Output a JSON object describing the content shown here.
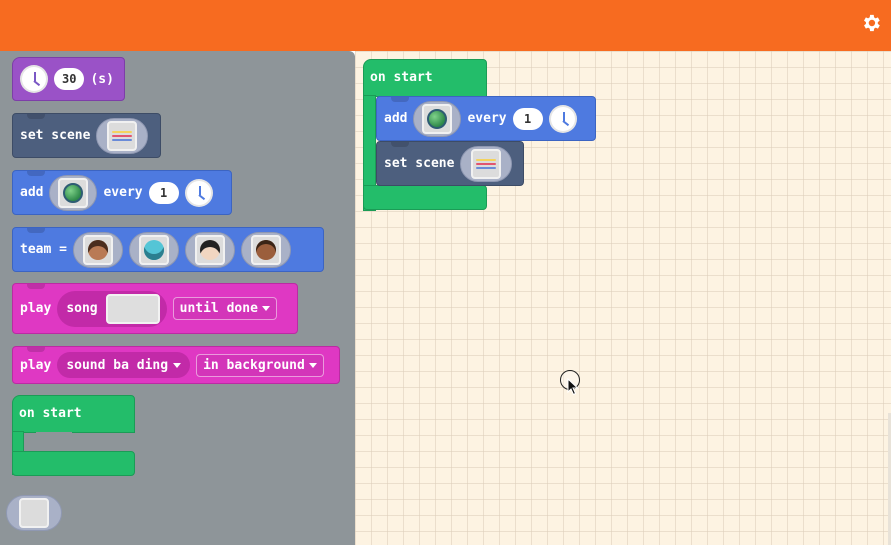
{
  "header": {
    "settings_icon": "gear-icon",
    "color": "#f76b20"
  },
  "toolbox": {
    "pause_block": {
      "value": "30",
      "unit": "(s)",
      "icon": "clock-icon"
    },
    "set_scene_block": {
      "label": "set scene",
      "icon": "scene-thumbnail-icon"
    },
    "add_every_block": {
      "add_label": "add",
      "every_label": "every",
      "value": "1",
      "icon": "clock-icon"
    },
    "team_block": {
      "label": "team =",
      "members": [
        "character-1-icon",
        "character-2-icon",
        "character-3-icon",
        "character-4-icon"
      ]
    },
    "play_song_block": {
      "label": "play",
      "song_label": "song",
      "mode": "until done"
    },
    "play_sound_block": {
      "label": "play",
      "sound": "sound ba ding",
      "mode": "in background"
    },
    "on_start_block": {
      "label": "on start"
    },
    "empty_slot": {
      "icon": "empty-value-slot"
    }
  },
  "workspace": {
    "on_start": {
      "label": "on start"
    },
    "add_every": {
      "add_label": "add",
      "every_label": "every",
      "value": "1"
    },
    "set_scene": {
      "label": "set scene"
    }
  },
  "colors": {
    "loops": "#9a52c7",
    "scene": "#4d5f7e",
    "sprites": "#4e7ae0",
    "music": "#df38c3",
    "events": "#23bd6a"
  }
}
